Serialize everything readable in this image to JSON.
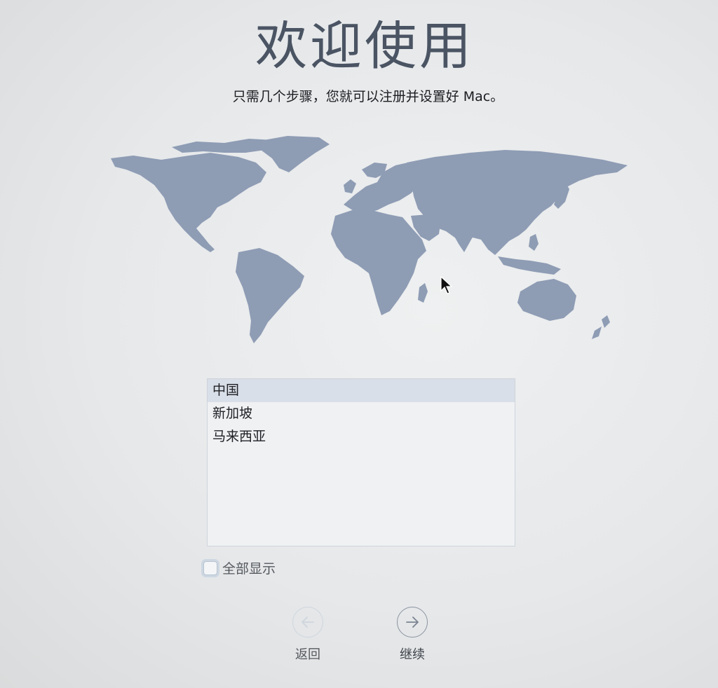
{
  "header": {
    "title": "欢迎使用",
    "subtitle": "只需几个步骤，您就可以注册并设置好 Mac。"
  },
  "region_list": {
    "items": [
      {
        "label": "中国",
        "selected": true
      },
      {
        "label": "新加坡",
        "selected": false
      },
      {
        "label": "马来西亚",
        "selected": false
      }
    ]
  },
  "show_all": {
    "label": "全部显示",
    "checked": false
  },
  "navigation": {
    "back_label": "返回",
    "back_icon": "arrow-left-circle-icon",
    "back_enabled": false,
    "continue_label": "继续",
    "continue_icon": "arrow-right-circle-icon",
    "continue_enabled": true
  },
  "colors": {
    "map_land": "#8e9cb4",
    "title": "#4a5463",
    "selection": "#d9dfe8"
  }
}
